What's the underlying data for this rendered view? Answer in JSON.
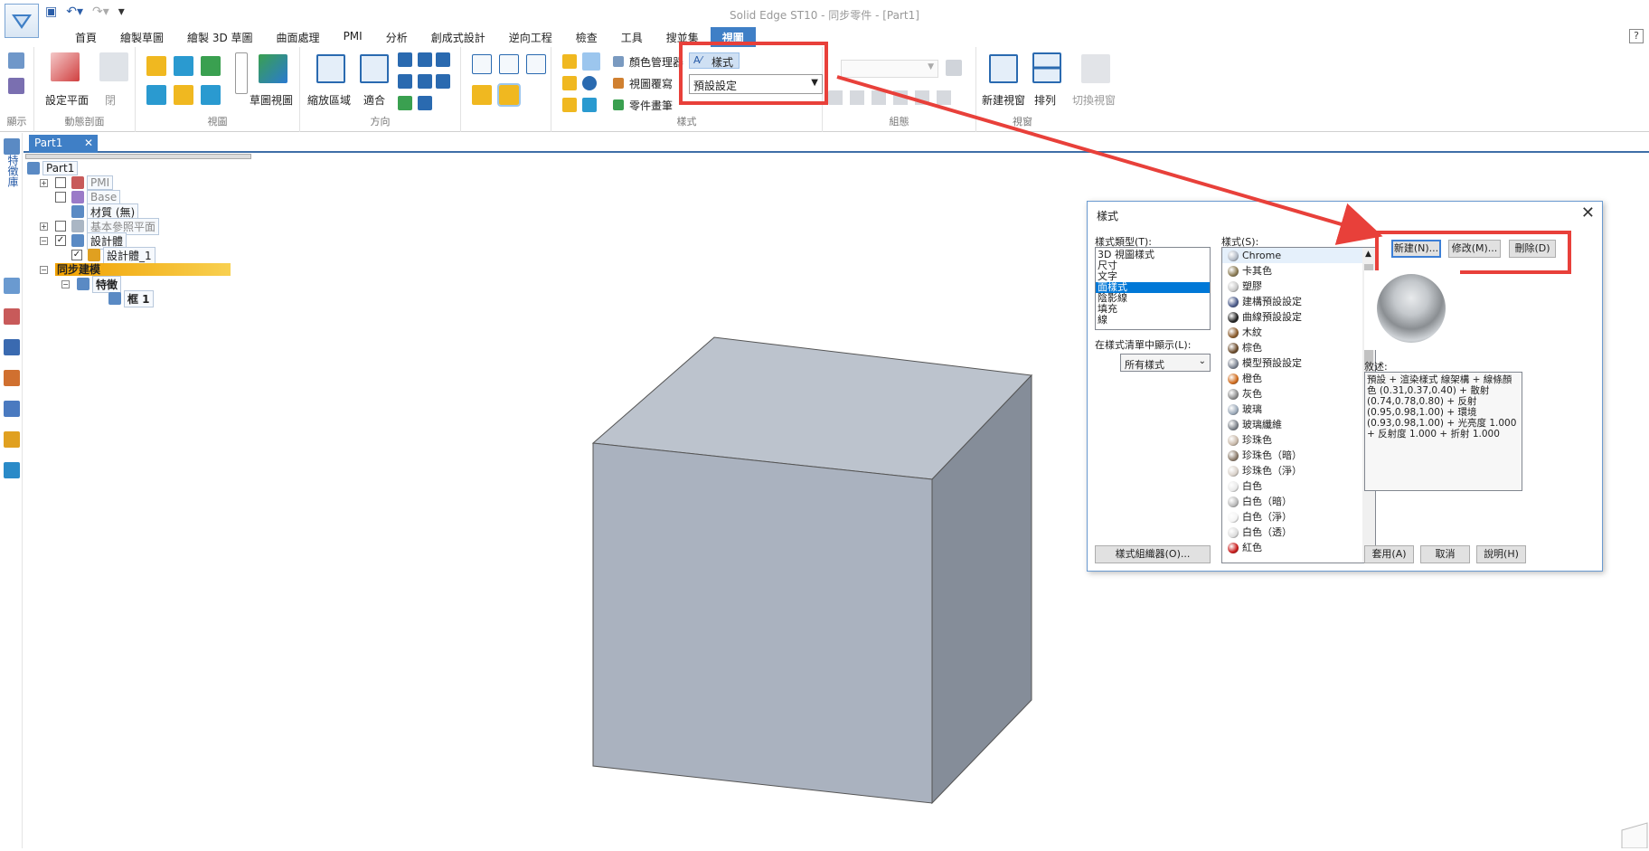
{
  "app": {
    "title": "Solid Edge ST10 - 同步零件 - [Part1]",
    "help_label": "?"
  },
  "menu_tabs": [
    "首頁",
    "繪製草圖",
    "繪製 3D 草圖",
    "曲面處理",
    "PMI",
    "分析",
    "創成式設計",
    "逆向工程",
    "檢查",
    "工具",
    "搜並集",
    "視圖"
  ],
  "active_tab": "視圖",
  "ribbon": {
    "groups": {
      "display": "顯示",
      "dynamic_section": "動態剖面",
      "views": "視圖",
      "orient": "方向",
      "style": "樣式",
      "assemblies": "組態",
      "window": "視窗"
    },
    "labels": {
      "set_plane": "設定平面",
      "close": "閉",
      "sketch_view": "草圖視圖",
      "zoom_area": "縮放區域",
      "fit": "適合",
      "color_manager": "顏色管理器",
      "view_overlay": "視圖覆寫",
      "part_painter": "零件畫筆",
      "styles_button": "樣式",
      "style_dropdown_value": "預設設定",
      "new_window": "新建視窗",
      "arrange": "排列",
      "switch_window": "切換視窗"
    }
  },
  "document_tab": {
    "label": "Part1",
    "close": "✕"
  },
  "sidebar": {
    "pathfinder_label": "特徵庫"
  },
  "tree": {
    "root": "Part1",
    "items": [
      "PMI",
      "Base",
      "材質 (無)",
      "基本參照平面",
      "設計體",
      "設計體_1",
      "同步建模",
      "特徵",
      "框 1"
    ]
  },
  "dialog": {
    "title": "樣式",
    "close": "✕",
    "type_label": "樣式類型(T):",
    "types": [
      "3D 視圖樣式",
      "尺寸",
      "文字",
      "面樣式",
      "陰影線",
      "填充",
      "線"
    ],
    "selected_type": "面樣式",
    "list_show_label": "在樣式清單中顯示(L):",
    "list_show_value": "所有樣式",
    "organizer_button": "樣式組織器(O)...",
    "styles_label": "樣式(S):",
    "styles": [
      {
        "name": "Chrome",
        "color": "#b0b8c4"
      },
      {
        "name": "卡其色",
        "color": "#8a7a52"
      },
      {
        "name": "塑膠",
        "color": "#c8c8c8"
      },
      {
        "name": "建構預設設定",
        "color": "#4a5a8a"
      },
      {
        "name": "曲線預設設定",
        "color": "#222222"
      },
      {
        "name": "木紋",
        "color": "#8a5a2a"
      },
      {
        "name": "棕色",
        "color": "#6a4a2a"
      },
      {
        "name": "模型預設設定",
        "color": "#7a8290"
      },
      {
        "name": "橙色",
        "color": "#d06a1a"
      },
      {
        "name": "灰色",
        "color": "#8a8a8a"
      },
      {
        "name": "玻璃",
        "color": "#9aa8b8"
      },
      {
        "name": "玻璃纖維",
        "color": "#7a8088"
      },
      {
        "name": "珍珠色",
        "color": "#c8b8a8"
      },
      {
        "name": "珍珠色（暗）",
        "color": "#8a7a6a"
      },
      {
        "name": "珍珠色（淨）",
        "color": "#d8d0c8"
      },
      {
        "name": "白色",
        "color": "#e8e8e8"
      },
      {
        "name": "白色（暗）",
        "color": "#b8b8b8"
      },
      {
        "name": "白色（淨）",
        "color": "#f4f4f4"
      },
      {
        "name": "白色（透）",
        "color": "#dcdcdc"
      },
      {
        "name": "紅色",
        "color": "#c81818"
      }
    ],
    "selected_style": "Chrome",
    "new_button": "新建(N)...",
    "modify_button": "修改(M)...",
    "delete_button": "刪除(D)",
    "description_label": "敘述:",
    "description": "預設 + 渲染樣式 線架構 + 線條顏色 (0.31,0.37,0.40) + 散射 (0.74,0.78,0.80) + 反射 (0.95,0.98,1.00) + 環境 (0.93,0.98,1.00) + 光亮度 1.000 + 反射度 1.000 + 折射 1.000",
    "apply_button": "套用(A)",
    "cancel_button": "取消",
    "help_button": "說明(H)"
  },
  "colors": {
    "accent": "#3f7fc6",
    "highlight": "#e8403a",
    "cube_front": "#aab2bf",
    "cube_top": "#bcc3cd",
    "cube_side": "#858d99"
  }
}
